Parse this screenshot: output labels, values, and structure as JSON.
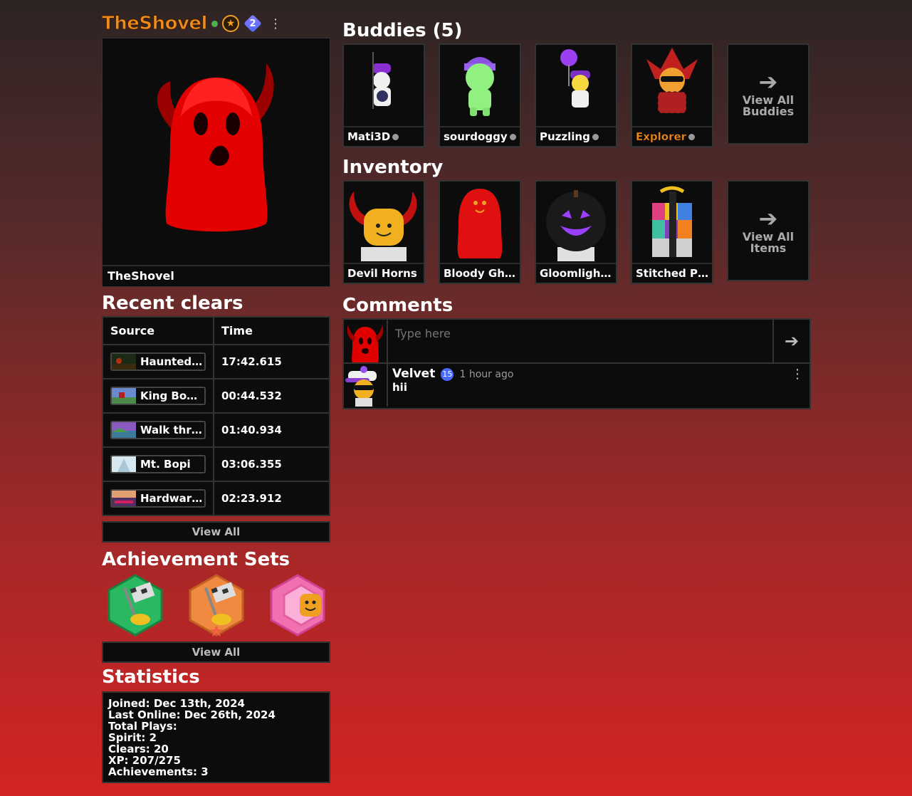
{
  "profile": {
    "username": "TheShovel",
    "level": "2",
    "avatar_label": "TheShovel"
  },
  "sections": {
    "recent_clears": "Recent clears",
    "achievement_sets": "Achievement Sets",
    "statistics": "Statistics",
    "buddies": "Buddies (5)",
    "inventory": "Inventory",
    "comments": "Comments"
  },
  "clears": {
    "headers": [
      "Source",
      "Time"
    ],
    "rows": [
      {
        "source": "Haunted ...",
        "time": "17:42.615"
      },
      {
        "source": "King Bopi'...",
        "time": "00:44.532"
      },
      {
        "source": "Walk thro...",
        "time": "01:40.934"
      },
      {
        "source": "Mt. Bopi",
        "time": "03:06.355"
      },
      {
        "source": "Hardware...",
        "time": "02:23.912"
      }
    ],
    "view_all": "View All"
  },
  "achievements": {
    "view_all": "View All"
  },
  "stats": {
    "joined": "Joined: Dec 13th, 2024",
    "last_online": "Last Online: Dec 26th, 2024",
    "total_plays": "Total Plays:",
    "spirit": "Spirit: 2",
    "clears": "Clears: 20",
    "xp": "XP: 207/275",
    "achievements": "Achievements: 3"
  },
  "buddies": {
    "items": [
      "Mati3D",
      "sourdoggy",
      "Puzzling",
      "Explorer"
    ],
    "view_all_1": "View All",
    "view_all_2": "Buddies"
  },
  "inventory": {
    "items": [
      "Devil Horns",
      "Bloody Gho...",
      "Gloomlight ...",
      "Stitched Pr..."
    ],
    "view_all_1": "View All",
    "view_all_2": "Items"
  },
  "comments": {
    "placeholder": "Type here",
    "list": [
      {
        "user": "Velvet",
        "level": "15",
        "time": "1 hour ago",
        "text": "hii"
      }
    ]
  },
  "colors": {
    "accent": "#f08c1c",
    "panel": "#0c0c0c",
    "online": "#4caf50",
    "gem": "#4a6aff"
  }
}
